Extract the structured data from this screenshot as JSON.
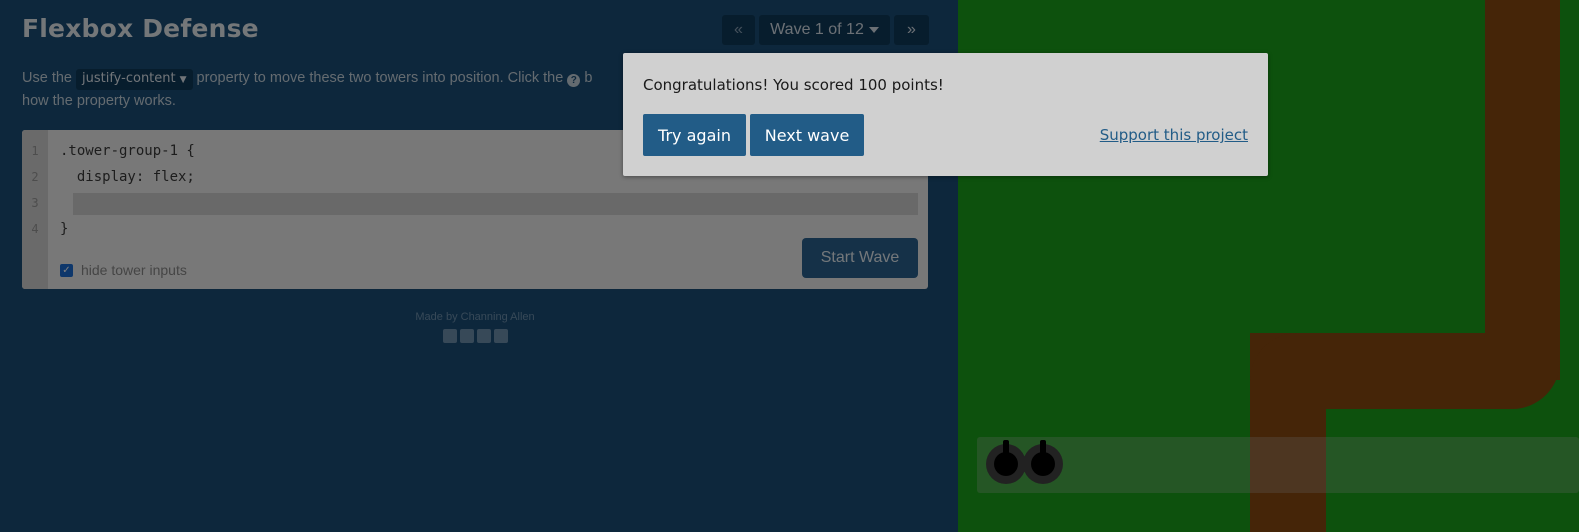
{
  "header": {
    "title": "Flexbox Defense",
    "prev_icon": "«",
    "wave_label": "Wave 1 of 12",
    "next_icon": "»"
  },
  "instructions": {
    "before": "Use the ",
    "property": "justify-content",
    "middle": " property to move these two towers into position. Click the ",
    "after_icon": " b",
    "line2": "how the property works."
  },
  "editor": {
    "line_numbers": [
      "1",
      "2",
      "3",
      "4"
    ],
    "line1": ".tower-group-1 {",
    "line2": "  display: flex;",
    "line4": "}",
    "hide_inputs_label": "hide tower inputs",
    "start_button": "Start Wave"
  },
  "footer": {
    "credit": "Made by Channing Allen",
    "social_icons": [
      "facebook-icon",
      "twitter-icon",
      "linkedin-icon",
      "github-icon"
    ]
  },
  "modal": {
    "message": "Congratulations! You scored 100 points!",
    "try_again": "Try again",
    "next_wave": "Next wave",
    "support_link": "Support this project"
  },
  "colors": {
    "panel": "#1b4f78",
    "grass": "#1aa31a",
    "path": "#8a4a10",
    "modal_button": "#225c87"
  }
}
